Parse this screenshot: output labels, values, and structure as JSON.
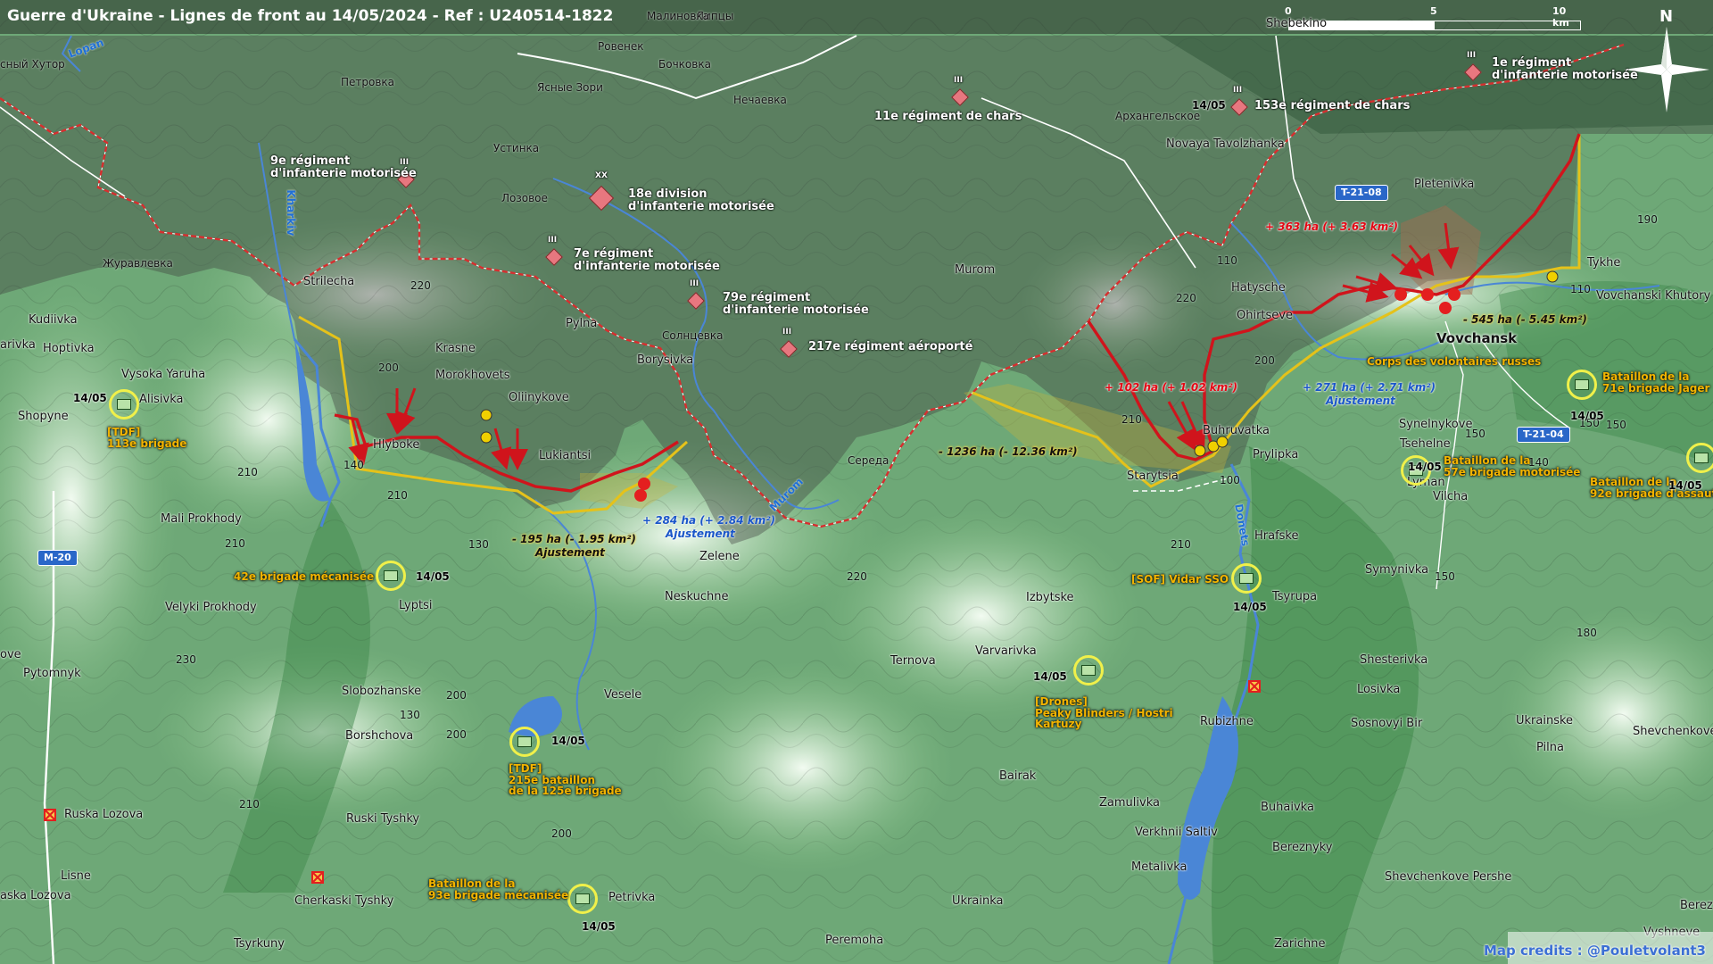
{
  "title": "Guerre d'Ukraine - Lignes de front au 14/05/2024 - Ref : U240514-1822",
  "credits": "Map credits : @Pouletvolant3",
  "scale": {
    "ticks": [
      "0",
      "5",
      "10 km"
    ]
  },
  "compass": {
    "north": "N"
  },
  "colors": {
    "russian_unit": "#e8777f",
    "ukrainian_unit_ring": "#f0f04a",
    "front_line_new": "#d0141c",
    "front_line_old": "#e5c21a",
    "border": "#d63a3a",
    "water": "#4a86d6"
  },
  "roads": [
    "M-20",
    "T-21-08",
    "T-21-04"
  ],
  "places": [
    "Липцы",
    "Ровенек",
    "Бочковка",
    "Петровка",
    "Ясные Зори",
    "Нечаевка",
    "Малиновка",
    "Устинка",
    "Лозовое",
    "Журавлевка",
    "Солнцевка",
    "Середа",
    "Архангельское",
    "Murom",
    "Strilecha",
    "Krasne",
    "Morokhovets",
    "Oliinykove",
    "Lukiantsi",
    "Hlyboke",
    "Pylna",
    "Borysivka",
    "Zelene",
    "Neskuchne",
    "Lyptsi",
    "Mali Prokhody",
    "Velyki Prokhody",
    "Vysoka Yaruha",
    "Alisivka",
    "Shopyne",
    "Kudiivka",
    "Hoptivka",
    "arivka",
    "Pytomnyk",
    "ove",
    "Slobozhanske",
    "Borshchova",
    "Ruska Lozova",
    "Ruski Tyshky",
    "Lisne",
    "aska Lozova",
    "Cherkaski Tyshky",
    "Tsyrkuny",
    "Vesele",
    "Petrivka",
    "Peremoha",
    "Ukrainka",
    "Bairak",
    "Zamulivka",
    "Verkhnii Saltiv",
    "Metalivka",
    "Rubizhne",
    "Ternova",
    "Varvarivka",
    "Izbytske",
    "Hrafske",
    "Tsyrupa",
    "Symynivka",
    "Shesterivka",
    "Losivka",
    "Sosnovyi Bir",
    "Ukrainske",
    "Shevchenkove",
    "Pilna",
    "Buhaivka",
    "Bereznyky",
    "Shevchenkove Pershe",
    "Zarichne",
    "Vyshneve",
    "Berez",
    "Starytsia",
    "Buhruvatka",
    "Prylipka",
    "Ohirtseve",
    "Hatysche",
    "Pletenivka",
    "Tykhe",
    "Vovchanski Khutory",
    "Synelnykove",
    "Tsehelne",
    "Lyman",
    "Vilcha",
    "Novaya Tavolzhanka",
    "Shebekino",
    "сный Хутор"
  ],
  "big_places": [
    "Vovchansk"
  ],
  "rivers": [
    "Kharkiv",
    "Lopan",
    "Murom",
    "Donets"
  ],
  "elevations": [
    "220",
    "200",
    "210",
    "140",
    "210",
    "130",
    "210",
    "220",
    "230",
    "200",
    "130",
    "200",
    "210",
    "200",
    "220",
    "210",
    "200",
    "210",
    "100",
    "110",
    "110",
    "140",
    "150",
    "150",
    "180",
    "190",
    "150",
    "150"
  ],
  "russian_units": [
    {
      "name": "9e régiment\nd'infanterie motorisée",
      "echelon": "III"
    },
    {
      "name": "18e division\nd'infanterie motorisée",
      "echelon": "XX"
    },
    {
      "name": "7e régiment\nd'infanterie motorisée",
      "echelon": "III"
    },
    {
      "name": "79e régiment\nd'infanterie motorisée",
      "echelon": "III"
    },
    {
      "name": "217e régiment aéroporté",
      "echelon": "III"
    },
    {
      "name": "11e régiment de chars",
      "echelon": "III"
    },
    {
      "name": "153e régiment de chars",
      "echelon": "III",
      "date": "14/05"
    },
    {
      "name": "1e régiment\nd'infanterie motorisée",
      "echelon": "III"
    }
  ],
  "ukrainian_units": [
    {
      "name": "[TDF]\n113e brigade",
      "date": "14/05"
    },
    {
      "name": "42e brigade mécanisée",
      "date": "14/05"
    },
    {
      "name": "[TDF]\n215e bataillon\nde la 125e brigade",
      "date": "14/05"
    },
    {
      "name": "Bataillon de la\n93e brigade mécanisée",
      "date": "14/05"
    },
    {
      "name": "[Drones]\nPeaky Blinders / Hostri\nKartuzy",
      "date": "14/05"
    },
    {
      "name": "[SOF] Vidar SSO",
      "date": "14/05"
    },
    {
      "name": "Corps des volontaires russes",
      "date": ""
    },
    {
      "name": "Bataillon de la\n57e brigade motorisée",
      "date": "14/05"
    },
    {
      "name": "Bataillon de la\n71e brigade Jager",
      "date": "14/05"
    },
    {
      "name": "Bataillon de la\n92e brigade d'assaut",
      "date": ""
    },
    {
      "name": "",
      "date": "14/05"
    }
  ],
  "area_changes": [
    {
      "text": "- 195 ha (- 1.95 km²)",
      "kind": "loss",
      "note": "Ajustement"
    },
    {
      "text": "+ 284 ha (+ 2.84 km²)",
      "kind": "adj",
      "note": "Ajustement"
    },
    {
      "text": "- 1236 ha (- 12.36 km²)",
      "kind": "loss",
      "note": ""
    },
    {
      "text": "+ 102 ha (+ 1.02 km²)",
      "kind": "gain",
      "note": ""
    },
    {
      "text": "+ 363 ha (+ 3.63 km²)",
      "kind": "gain",
      "note": ""
    },
    {
      "text": "- 545 ha (- 5.45 km²)",
      "kind": "loss",
      "note": ""
    },
    {
      "text": "+ 271 ha (+ 2.71 km²)",
      "kind": "adj",
      "note": "Ajustement"
    }
  ]
}
